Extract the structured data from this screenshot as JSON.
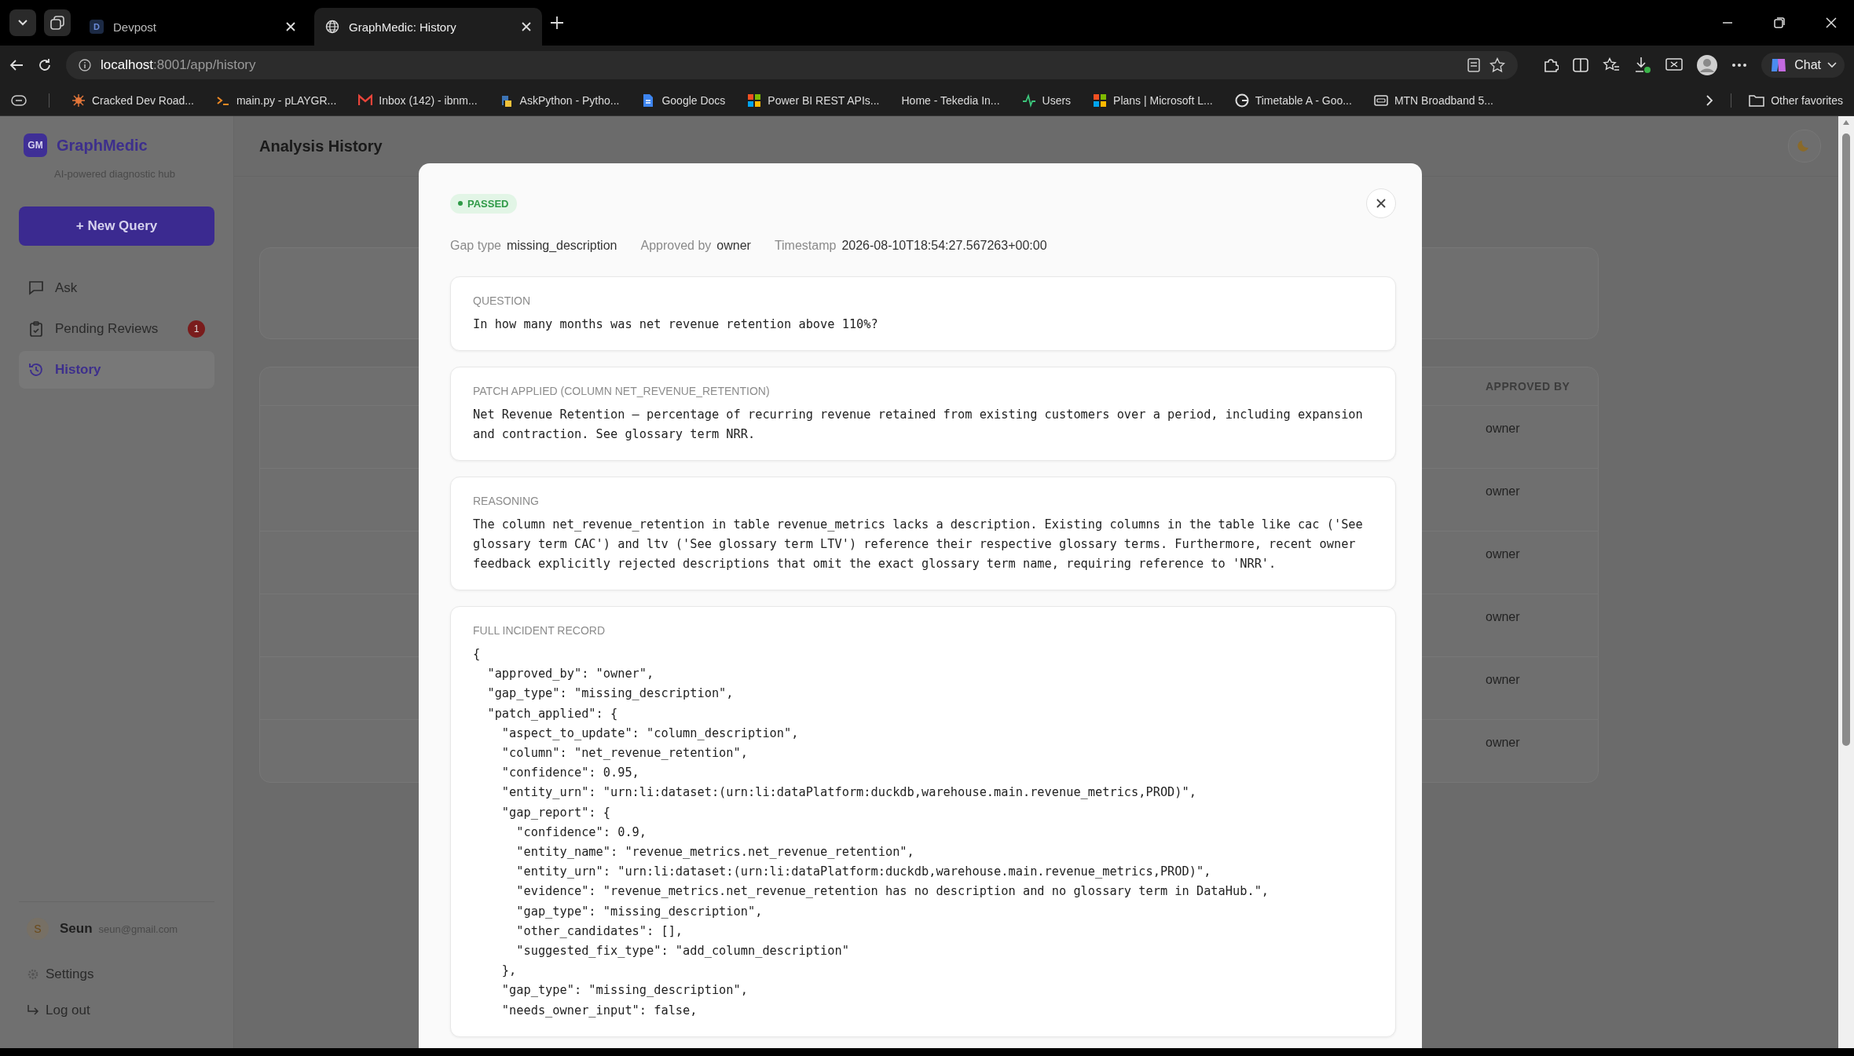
{
  "browser": {
    "tabs": [
      {
        "title": "Devpost",
        "favicon": "D",
        "selected": false
      },
      {
        "title": "GraphMedic: History",
        "selected": true
      }
    ],
    "url": "**localhost**:8001/app/history",
    "chat_label": "Chat",
    "bookmarks": [
      {
        "label": "Cracked Dev Road..."
      },
      {
        "label": "main.py - pLAYGR..."
      },
      {
        "label": "Inbox (142) - ibnm..."
      },
      {
        "label": "AskPython - Pytho..."
      },
      {
        "label": "Google Docs"
      },
      {
        "label": "Power BI REST APIs..."
      },
      {
        "label": "Home - Tekedia In..."
      },
      {
        "label": "Users"
      },
      {
        "label": "Plans | Microsoft L..."
      },
      {
        "label": "Timetable A - Goo..."
      },
      {
        "label": "MTN Broadband 5..."
      }
    ],
    "other_favorites": "Other favorites"
  },
  "sidebar": {
    "logo_mark": "GM",
    "brand": "GraphMedic",
    "tagline": "AI-powered diagnostic hub",
    "new_button": "+ New Query",
    "items": [
      {
        "label": "Ask",
        "selected": false
      },
      {
        "label": "Pending Reviews",
        "badge": "1",
        "selected": false
      },
      {
        "label": "History",
        "selected": true
      }
    ],
    "user": {
      "initial": "S",
      "name": "Seun",
      "email": "seun@gmail.com"
    },
    "footer_links": [
      {
        "label": "Settings"
      },
      {
        "label": "Log out"
      }
    ]
  },
  "header": {
    "title": "Analysis History"
  },
  "history_table": {
    "columns": [
      {
        "label": "APPROVED BY"
      }
    ],
    "rows": [
      {
        "approved_by": "owner"
      },
      {
        "approved_by": "owner"
      },
      {
        "approved_by": "owner"
      },
      {
        "approved_by": "owner"
      },
      {
        "approved_by": "owner"
      },
      {
        "approved_by": "owner"
      }
    ]
  },
  "modal": {
    "status": {
      "label": "PASSED",
      "kind": "passed"
    },
    "meta": [
      {
        "label": "Gap type",
        "value": "missing_description"
      },
      {
        "label": "Approved by",
        "value": "owner"
      },
      {
        "label": "Timestamp",
        "value": "2026-08-10T18:54:27.567263+00:00"
      }
    ],
    "sections": [
      {
        "label": "QUESTION",
        "text": "In how many months was net revenue retention above 110%?"
      },
      {
        "label": "PATCH APPLIED (COLUMN NET_REVENUE_RETENTION)",
        "text": "Net Revenue Retention — percentage of recurring revenue retained from existing customers over a period, including expansion and contraction. See glossary term NRR."
      },
      {
        "label": "REASONING",
        "text": "The column net_revenue_retention in table revenue_metrics lacks a description. Existing columns in the table like cac ('See glossary term CAC') and ltv ('See glossary term LTV') reference their respective glossary terms. Furthermore, recent owner feedback explicitly rejected descriptions that omit the exact glossary term name, requiring reference to 'NRR'."
      }
    ],
    "record": {
      "label": "FULL INCIDENT RECORD",
      "lines": [
        "{",
        "  \"approved_by\": \"owner\",",
        "  \"gap_type\": \"missing_description\",",
        "  \"patch_applied\": {",
        "    \"aspect_to_update\": \"column_description\",",
        "    \"column\": \"net_revenue_retention\",",
        "    \"confidence\": 0.95,",
        "    \"entity_urn\": \"urn:li:dataset:(urn:li:dataPlatform:duckdb,warehouse.main.revenue_metrics,PROD)\",",
        "    \"gap_report\": {",
        "      \"confidence\": 0.9,",
        "      \"entity_name\": \"revenue_metrics.net_revenue_retention\",",
        "      \"entity_urn\": \"urn:li:dataset:(urn:li:dataPlatform:duckdb,warehouse.main.revenue_metrics,PROD)\",",
        "      \"evidence\": \"revenue_metrics.net_revenue_retention has no description and no glossary term in DataHub.\",",
        "      \"gap_type\": \"missing_description\",",
        "      \"other_candidates\": [],",
        "      \"suggested_fix_type\": \"add_column_description\"",
        "    },",
        "    \"gap_type\": \"missing_description\",",
        "    \"needs_owner_input\": false,"
      ]
    }
  }
}
